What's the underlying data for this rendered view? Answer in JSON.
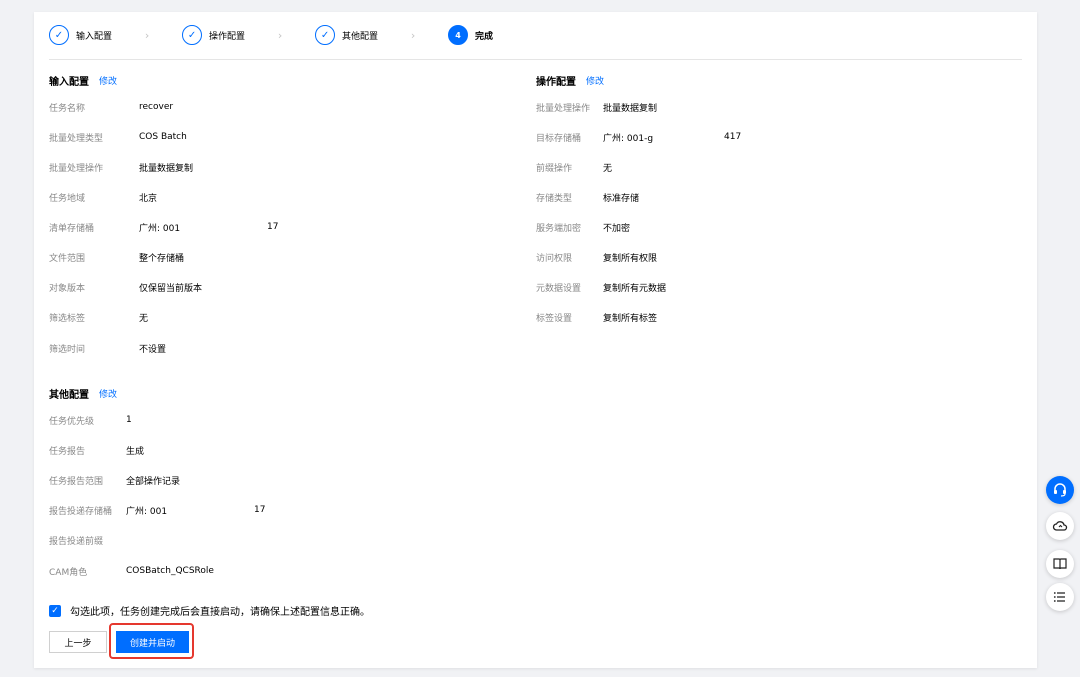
{
  "steps": [
    {
      "label": "输入配置",
      "state": "done"
    },
    {
      "label": "操作配置",
      "state": "done"
    },
    {
      "label": "其他配置",
      "state": "done"
    },
    {
      "label": "完成",
      "number": "4",
      "state": "active"
    }
  ],
  "step_separator": "›",
  "input_config": {
    "title": "输入配置",
    "edit": "修改",
    "fields": [
      {
        "key": "任务名称",
        "value": "recover"
      },
      {
        "key": "批量处理类型",
        "value": "COS Batch"
      },
      {
        "key": "批量处理操作",
        "value": "批量数据复制"
      },
      {
        "key": "任务地域",
        "value": "北京"
      },
      {
        "key": "清单存储桶",
        "value": "广州: 001",
        "value_suffix": "17"
      },
      {
        "key": "文件范围",
        "value": "整个存储桶"
      },
      {
        "key": "对象版本",
        "value": "仅保留当前版本"
      },
      {
        "key": "筛选标签",
        "value": "无"
      },
      {
        "key": "筛选时间",
        "value": "不设置"
      }
    ]
  },
  "operation_config": {
    "title": "操作配置",
    "edit": "修改",
    "fields": [
      {
        "key": "批量处理操作",
        "value": "批量数据复制"
      },
      {
        "key": "目标存储桶",
        "value": "广州: 001-g",
        "value_suffix": "417"
      },
      {
        "key": "前缀操作",
        "value": "无"
      },
      {
        "key": "存储类型",
        "value": "标准存储"
      },
      {
        "key": "服务端加密",
        "value": "不加密"
      },
      {
        "key": "访问权限",
        "value": "复制所有权限"
      },
      {
        "key": "元数据设置",
        "value": "复制所有元数据"
      },
      {
        "key": "标签设置",
        "value": "复制所有标签"
      }
    ]
  },
  "other_config": {
    "title": "其他配置",
    "edit": "修改",
    "fields": [
      {
        "key": "任务优先级",
        "value": "1"
      },
      {
        "key": "任务报告",
        "value": "生成"
      },
      {
        "key": "任务报告范围",
        "value": "全部操作记录"
      },
      {
        "key": "报告投递存储桶",
        "value": "广州: 001",
        "value_suffix": "17"
      },
      {
        "key": "报告投递前缀",
        "value": ""
      },
      {
        "key": "CAM角色",
        "value": "COSBatch_QCSRole"
      }
    ]
  },
  "agree": {
    "checked": true,
    "text": "勾选此项，任务创建完成后会直接启动，请确保上述配置信息正确。"
  },
  "buttons": {
    "prev": "上一步",
    "create": "创建并启动"
  },
  "colors": {
    "accent": "#006eff",
    "highlight": "#e5382e"
  },
  "floating_icons": [
    "headset-icon",
    "cloud-icon",
    "book-icon",
    "list-icon"
  ]
}
